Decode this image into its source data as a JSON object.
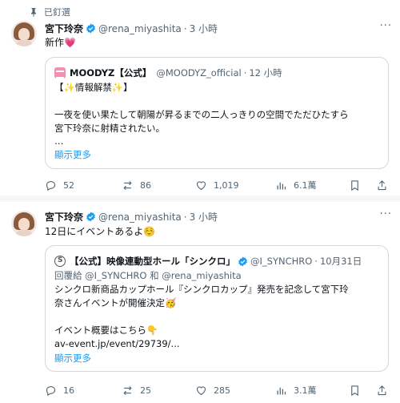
{
  "tweet1": {
    "pinned_label": "已釘選",
    "name": "宮下玲奈",
    "handle": "@rena_miyashita",
    "time": "3 小時",
    "text": "新作",
    "text_emoji": "💗",
    "quote": {
      "name": "MOODYZ【公式】",
      "handle": "@MOODYZ_official",
      "time": "12 小時",
      "line1": "【✨情報解禁✨】",
      "line2": "一夜を使い果たして朝陽が昇るまでの二人っきりの空間でただひたすら",
      "line3": "宮下玲奈に射精されたい。",
      "line4": "…",
      "show_more": "顯示更多"
    },
    "stats": {
      "replies": "52",
      "reposts": "86",
      "likes": "1,019",
      "views": "6.1萬"
    }
  },
  "tweet2": {
    "name": "宮下玲奈",
    "handle": "@rena_miyashita",
    "time": "3 小時",
    "text": "12日にイベントあるよ☺️",
    "quote": {
      "name": "【公式】映像連動型ホール「シンクロ」",
      "handle": "@I_SYNCHRO",
      "time": "10月31日",
      "reply_to": "回覆給 @I_SYNCHRO 和 @rena_miyashita",
      "line1": "シンクロ新商品カップホール『シンクロカップ』発売を記念して宮下玲",
      "line2": "奈さんイベントが開催決定🥳",
      "line3": "イベント概要はこちら👇",
      "line4": "av-event.jp/event/29739/...",
      "show_more": "顯示更多"
    },
    "stats": {
      "replies": "16",
      "reposts": "25",
      "likes": "285",
      "views": "3.1萬"
    }
  },
  "colors": {
    "verified": "#1d9bf0",
    "link": "#1d9bf0",
    "secondary_text": "#536471",
    "border": "#cfd9de"
  }
}
